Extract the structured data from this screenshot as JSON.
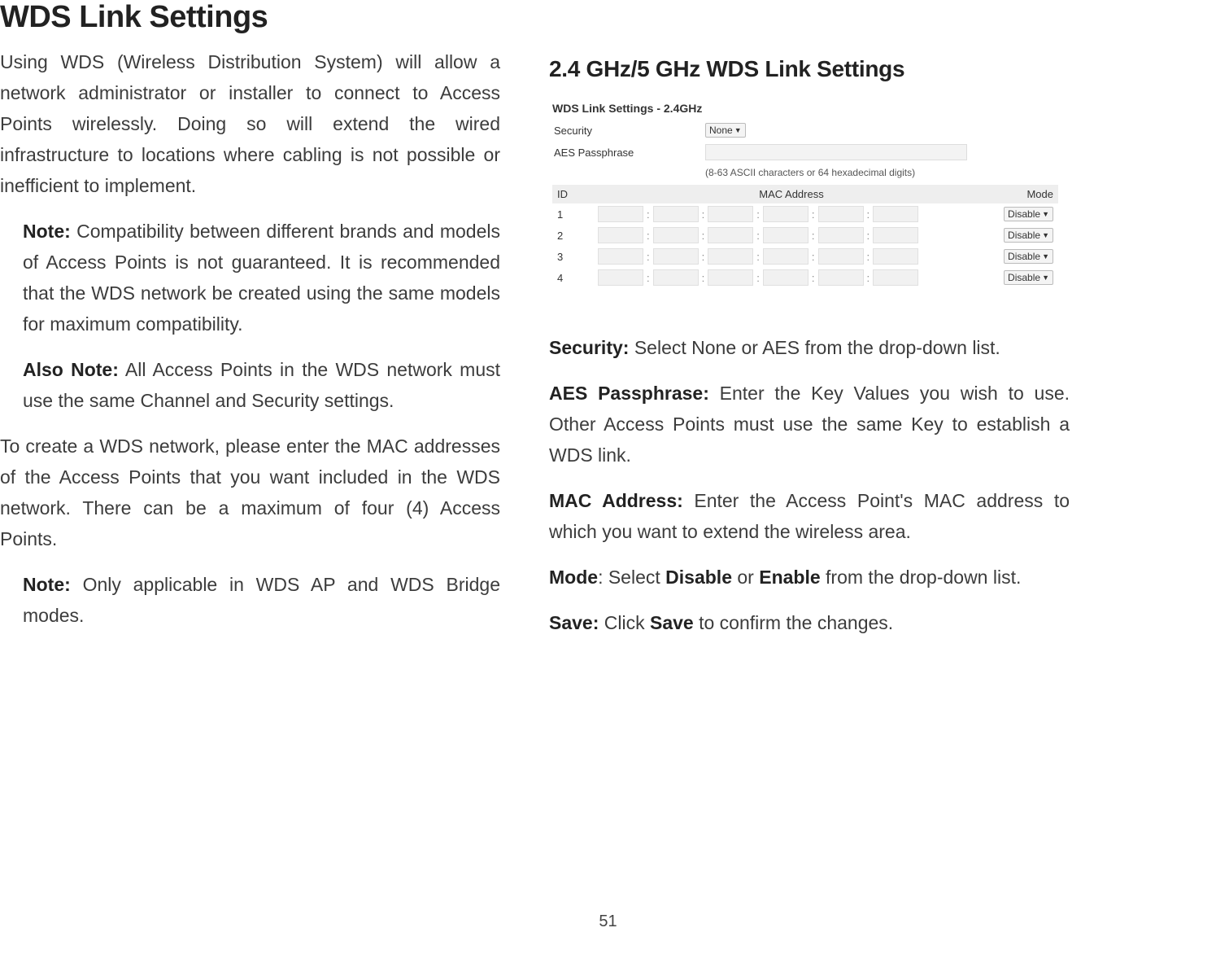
{
  "page_number": "51",
  "main_title": "WDS Link Settings",
  "left": {
    "p1": "Using WDS (Wireless Distribution System) will allow a network administrator or installer to connect to Access Points wirelessly. Doing so will extend the wired infrastructure to locations where cabling is not possible or inefficient to implement.",
    "note1_label": "Note:",
    "note1_body": " Compatibility between different brands and models of Access Points is not guaranteed. It is recommended that the WDS network be created using the same models for maximum compatibility.",
    "note2_label": "Also Note:",
    "note2_body": " All Access Points in the WDS network must use the same Channel and Security settings.",
    "p2": "To create a WDS network, please enter the MAC addresses of the Access Points that you want included in the WDS network. There can be a maximum of four (4) Access Points.",
    "note3_label": "Note:",
    "note3_body": " Only applicable in WDS AP and WDS Bridge modes."
  },
  "right": {
    "heading": "2.4 GHz/5 GHz WDS Link Settings",
    "shot": {
      "title": "WDS Link Settings - 2.4GHz",
      "security_label": "Security",
      "security_value": "None",
      "aes_label": "AES Passphrase",
      "aes_hint": "(8-63 ASCII characters or 64 hexadecimal digits)",
      "th_id": "ID",
      "th_mac": "MAC Address",
      "th_mode": "Mode",
      "mode_value": "Disable",
      "rows": [
        "1",
        "2",
        "3",
        "4"
      ]
    },
    "security_label": "Security:",
    "security_body": " Select None or AES from the drop-down list.",
    "aes_label": "AES Passphrase:",
    "aes_body": " Enter the Key Values you wish to use. Other Access Points must use the same Key to establish a WDS link.",
    "mac_label": "MAC Address:",
    "mac_body": " Enter the Access Point's MAC address to which you want to extend the wireless area.",
    "mode_label": "Mode",
    "mode_body1": ": Select ",
    "mode_bold1": "Disable",
    "mode_body2": " or ",
    "mode_bold2": "Enable",
    "mode_body3": " from the drop-down list.",
    "save_label": "Save:",
    "save_body1": " Click ",
    "save_bold": "Save",
    "save_body2": " to confirm the changes."
  }
}
